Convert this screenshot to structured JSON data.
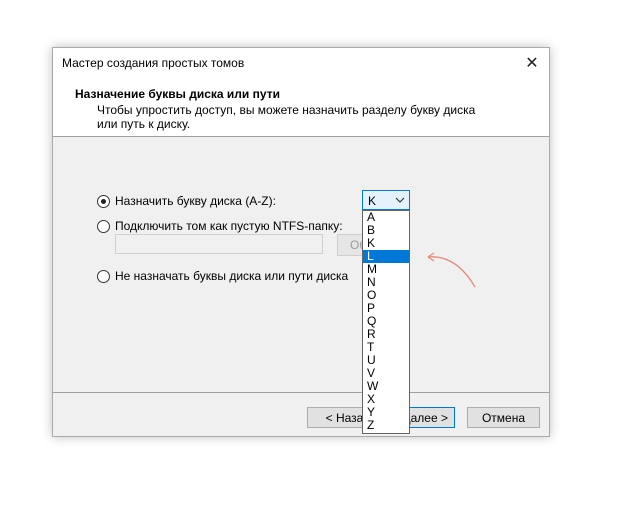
{
  "window": {
    "title": "Мастер создания простых томов",
    "close_glyph": "✕"
  },
  "header": {
    "title": "Назначение буквы диска или пути",
    "subtitle": "Чтобы упростить доступ, вы можете назначить разделу букву диска или путь к диску."
  },
  "options": {
    "assign_letter": "Назначить букву диска (A-Z):",
    "mount_folder": "Подключить том как пустую NTFS-папку:",
    "no_letter": "Не назначать буквы диска или пути диска",
    "browse_label": "Обзор...",
    "path_value": ""
  },
  "drive_select": {
    "selected_value": "K",
    "letters": [
      "A",
      "B",
      "K",
      "L",
      "M",
      "N",
      "O",
      "P",
      "Q",
      "R",
      "T",
      "U",
      "V",
      "W",
      "X",
      "Y",
      "Z"
    ],
    "highlighted": "L"
  },
  "buttons": {
    "back": "< Назад",
    "next": "Далее >",
    "cancel": "Отмена"
  },
  "colors": {
    "accent": "#0078d7",
    "annotation": "#e8897c"
  }
}
